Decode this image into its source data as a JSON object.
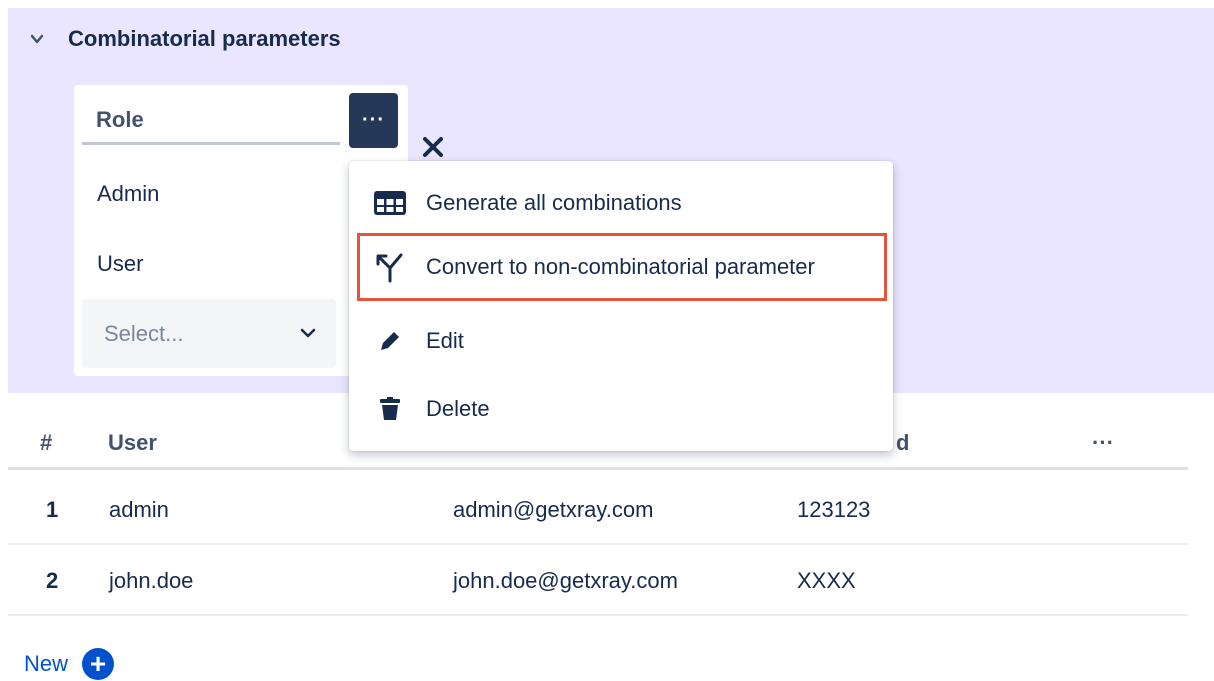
{
  "section": {
    "title": "Combinatorial parameters"
  },
  "parameter": {
    "name": "Role",
    "more_label": "···",
    "values": [
      "Admin",
      "User"
    ],
    "select_placeholder": "Select..."
  },
  "menu": {
    "items": [
      {
        "label": "Generate all combinations",
        "icon": "table-icon"
      },
      {
        "label": "Convert to non-combinatorial parameter",
        "icon": "split-icon",
        "highlighted": true
      },
      {
        "label": "Edit",
        "icon": "pencil-icon"
      },
      {
        "label": "Delete",
        "icon": "trash-icon"
      }
    ]
  },
  "table": {
    "headers": [
      "#",
      "User",
      "d",
      "···"
    ],
    "rows": [
      {
        "num": "1",
        "user": "admin",
        "email": "admin@getxray.com",
        "password": "123123"
      },
      {
        "num": "2",
        "user": "john.doe",
        "email": "john.doe@getxray.com",
        "password": "XXXX"
      }
    ]
  },
  "new_link": {
    "label": "New",
    "plus": "+"
  },
  "colors": {
    "panel_bg": "#eae6ff",
    "primary": "#0052cc",
    "dark_button": "#253858",
    "highlight": "#e5533d"
  }
}
